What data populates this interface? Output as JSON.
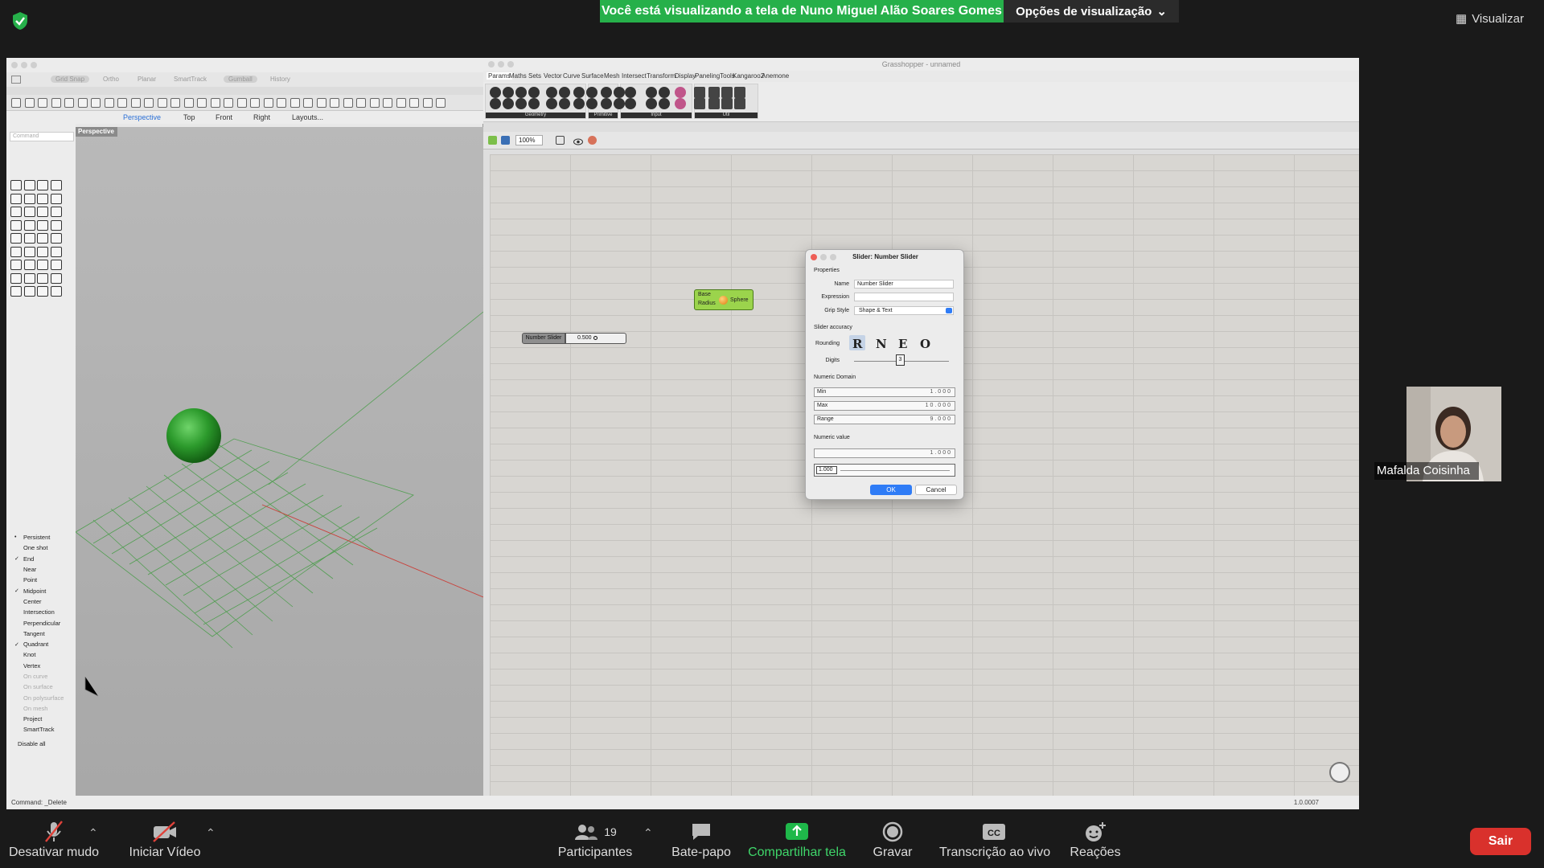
{
  "zoom": {
    "banner": "Você está visualizando a tela de Nuno Miguel Alão Soares Gomes",
    "view_options": "Opções de visualização",
    "visualizar": "Visualizar",
    "participant_name": "Mafalda Coisinha",
    "toolbar": {
      "mute": "Desativar mudo",
      "video": "Iniciar Vídeo",
      "participants": "Participantes",
      "participants_count": "19",
      "chat": "Bate-papo",
      "share": "Compartilhar tela",
      "record": "Gravar",
      "transcription": "Transcrição ao vivo",
      "reactions": "Reações",
      "leave": "Sair"
    },
    "colors": {
      "banner": "#26b04a",
      "leave": "#d9312c",
      "share": "#1fb84a"
    }
  },
  "rhino": {
    "tabs": [
      "Grid Snap",
      "Ortho",
      "Planar",
      "SmartTrack",
      "Gumball",
      "History"
    ],
    "viewport_tabs": [
      "Perspective",
      "Top",
      "Front",
      "Right",
      "Layouts..."
    ],
    "command_placeholder": "Command",
    "viewport_label": "Perspective",
    "osnap": [
      {
        "label": "Persistent",
        "mark": "•",
        "dim": false
      },
      {
        "label": "One shot",
        "mark": "",
        "dim": false
      },
      {
        "label": "End",
        "mark": "✓",
        "dim": false
      },
      {
        "label": "Near",
        "mark": "",
        "dim": false
      },
      {
        "label": "Point",
        "mark": "",
        "dim": false
      },
      {
        "label": "Midpoint",
        "mark": "✓",
        "dim": false
      },
      {
        "label": "Center",
        "mark": "",
        "dim": false
      },
      {
        "label": "Intersection",
        "mark": "",
        "dim": false
      },
      {
        "label": "Perpendicular",
        "mark": "",
        "dim": false
      },
      {
        "label": "Tangent",
        "mark": "",
        "dim": false
      },
      {
        "label": "Quadrant",
        "mark": "✓",
        "dim": false
      },
      {
        "label": "Knot",
        "mark": "",
        "dim": false
      },
      {
        "label": "Vertex",
        "mark": "",
        "dim": false
      },
      {
        "label": "On curve",
        "mark": "",
        "dim": true
      },
      {
        "label": "On surface",
        "mark": "",
        "dim": true
      },
      {
        "label": "On polysurface",
        "mark": "",
        "dim": true
      },
      {
        "label": "On mesh",
        "mark": "",
        "dim": true
      },
      {
        "label": "Project",
        "mark": "",
        "dim": false
      },
      {
        "label": "SmartTrack",
        "mark": "",
        "dim": false
      }
    ],
    "disable_all": "Disable all",
    "status": "Command: _Delete"
  },
  "grasshopper": {
    "title": "Grasshopper - unnamed",
    "menu": [
      "Params",
      "Maths",
      "Sets",
      "Vector",
      "Curve",
      "Surface",
      "Mesh",
      "Intersect",
      "Transform",
      "Display",
      "PanelingTools",
      "Kangaroo2",
      "Anemone"
    ],
    "ribbon_groups": [
      "Geometry",
      "Primitive",
      "Input",
      "Util"
    ],
    "zoom": "100%",
    "status_right": "1.0.0007",
    "slider_component": {
      "label": "Number Slider",
      "value": "0.500"
    },
    "sphere_component": {
      "inputs": [
        "Base",
        "Radius"
      ],
      "output": "Sphere"
    }
  },
  "dialog": {
    "title": "Slider: Number Slider",
    "properties": "Properties",
    "name_label": "Name",
    "name_value": "Number Slider",
    "expression_label": "Expression",
    "expression_value": "",
    "grip_label": "Grip Style",
    "grip_value": "Shape & Text",
    "accuracy": "Slider accuracy",
    "rounding_label": "Rounding",
    "rounding_options": [
      "R",
      "N",
      "E",
      "O"
    ],
    "digits_label": "Digits",
    "digits_value": "3",
    "numeric_domain": "Numeric Domain",
    "min_label": "Min",
    "min_value": "1.000",
    "max_label": "Max",
    "max_value": "10.000",
    "range_label": "Range",
    "range_value": "9.000",
    "numeric_value": "Numeric value",
    "value_readout": "1.000",
    "value_field": "1.000",
    "ok": "OK",
    "cancel": "Cancel"
  }
}
